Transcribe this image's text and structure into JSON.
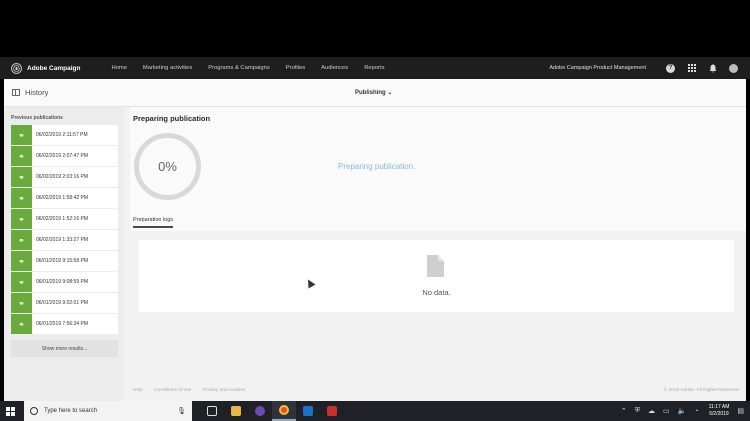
{
  "appbar": {
    "logo_text": "Adobe Campaign",
    "nav": [
      "Home",
      "Marketing activities",
      "Programs & Campaigns",
      "Profiles",
      "Audiences",
      "Reports"
    ],
    "org": "Adobe Campaign Product Management"
  },
  "subheader": {
    "history_label": "History",
    "publishing_label": "Publishing ⌄"
  },
  "sidebar": {
    "title": "Previous publications",
    "items": [
      "06/02/2019 2:11:57 PM",
      "06/02/2019 2:07:47 PM",
      "06/02/2019 2:03:16 PM",
      "06/02/2019 1:58:42 PM",
      "06/02/2019 1:52:16 PM",
      "06/02/2019 1:33:27 PM",
      "06/01/2019 9:15:58 PM",
      "06/01/2019 9:08:59 PM",
      "06/01/2019 9:02:01 PM",
      "06/01/2019 7:56:34 PM"
    ],
    "more_label": "Show more results..."
  },
  "main": {
    "title": "Preparing publication",
    "progress_percent": 0,
    "progress_text": "0%",
    "status_message": "Preparing publication.",
    "logs_tab": "Preparation logs",
    "no_data": "No data."
  },
  "footer": {
    "links": [
      "Help",
      "Conditions of use",
      "Privacy and cookies"
    ],
    "copyright": "© 2019 Adobe. All Rights Reserved."
  },
  "taskbar": {
    "search_placeholder": "Type here to search",
    "time": "11:17 AM",
    "date": "6/2/2019"
  }
}
